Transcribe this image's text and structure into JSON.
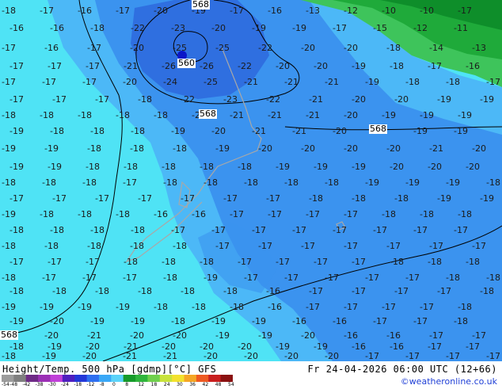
{
  "footer": {
    "title": "Height/Temp. 500 hPa [gdmp][°C] GFS",
    "datetime": "Fr 24-04-2026 06:00 UTC (12+66)",
    "credit": "©weatheronline.co.uk"
  },
  "colorbar": {
    "ticks": [
      "-54",
      "-48",
      "-42",
      "-38",
      "-30",
      "-24",
      "-18",
      "-12",
      "-8",
      "0",
      "8",
      "12",
      "18",
      "24",
      "30",
      "36",
      "42",
      "48",
      "54"
    ],
    "colors": [
      "#9c9c9c",
      "#7f7f7f",
      "#6e2a86",
      "#9b2fb5",
      "#c040d8",
      "#4f1fbf",
      "#2337d8",
      "#2e6ff0",
      "#3aa8f7",
      "#5bd3f9",
      "#169a2a",
      "#2fb53c",
      "#6fd04c",
      "#c8e23a",
      "#f3e12e",
      "#f5a626",
      "#ee5a22",
      "#c81e1e",
      "#8a1111"
    ]
  },
  "colors": {
    "band_cyan": "#4fe3f5",
    "band_light_blue": "#4cb8f7",
    "band_blue": "#3b93ef",
    "band_dark_blue": "#2f6fe0",
    "band_green_dark": "#0e8e2a",
    "band_green": "#1faa3a",
    "band_green_light": "#3ec45b",
    "land_outline": "#a8a8a8",
    "isoline": "#000000",
    "low_center": "#0a16c8"
  },
  "isoline_labels": [
    "568",
    "560",
    "568",
    "568",
    "568"
  ],
  "temperature_labels": [
    "-18",
    "-17",
    "-16",
    "-17",
    "-20",
    "-19",
    "-17",
    "-16",
    "-13",
    "-12",
    "-10",
    "-10",
    "-17",
    "-16",
    "-16",
    "-18",
    "-22",
    "-23",
    "-20",
    "-19",
    "-19",
    "-17",
    "-15",
    "-12",
    "-11",
    "-17",
    "-16",
    "-17",
    "-20",
    "-25",
    "-25",
    "-22",
    "-20",
    "-20",
    "-18",
    "-14",
    "-13",
    "-17",
    "-17",
    "-17",
    "-21",
    "-26",
    "-26",
    "-22",
    "-20",
    "-20",
    "-19",
    "-18",
    "-17",
    "-16",
    "-17",
    "-17",
    "-17",
    "-20",
    "-24",
    "-25",
    "-21",
    "-21",
    "-21",
    "-19",
    "-18",
    "-18",
    "-17",
    "-17",
    "-17",
    "-17",
    "-18",
    "-22",
    "-23",
    "-22",
    "-21",
    "-20",
    "-20",
    "-19",
    "-19",
    "-18",
    "-18",
    "-18",
    "-18",
    "-18",
    "-20",
    "-21",
    "-21",
    "-21",
    "-20",
    "-19",
    "-19",
    "-19",
    "-19",
    "-18",
    "-18",
    "-18",
    "-19",
    "-20",
    "-21",
    "-21",
    "-20",
    "-20",
    "-19",
    "-19",
    "-19",
    "-19",
    "-18",
    "-18",
    "-18",
    "-19",
    "-20",
    "-20",
    "-20",
    "-20",
    "-21",
    "-20",
    "-19",
    "-19",
    "-18",
    "-18",
    "-18",
    "-18",
    "-18",
    "-19",
    "-19",
    "-19",
    "-20",
    "-20",
    "-20",
    "-18",
    "-18",
    "-18",
    "-17",
    "-18",
    "-18",
    "-18",
    "-18",
    "-18",
    "-19",
    "-19",
    "-19",
    "-18",
    "-17",
    "-17",
    "-17",
    "-17",
    "-17",
    "-17",
    "-17",
    "-18",
    "-18",
    "-18",
    "-19",
    "-19",
    "-19",
    "-18",
    "-18",
    "-18",
    "-16",
    "-16",
    "-17",
    "-17",
    "-17",
    "-17",
    "-18",
    "-18",
    "-18",
    "-18",
    "-18",
    "-18",
    "-18",
    "-17",
    "-17",
    "-17",
    "-17",
    "-17",
    "-17",
    "-17",
    "-17",
    "-18",
    "-18",
    "-18",
    "-18",
    "-18",
    "-17",
    "-17",
    "-17",
    "-17",
    "-17",
    "-17",
    "-17",
    "-17",
    "-17",
    "-17",
    "-18",
    "-18",
    "-18",
    "-17",
    "-17",
    "-17",
    "-17",
    "-18",
    "-18",
    "-18",
    "-18",
    "-17",
    "-17",
    "-17",
    "-18",
    "-19",
    "-17",
    "-17",
    "-17",
    "-17",
    "-17",
    "-18",
    "-18",
    "-18",
    "-18",
    "-18",
    "-18",
    "-18",
    "-18",
    "-16",
    "-17",
    "-17",
    "-17",
    "-17",
    "-18",
    "-19",
    "-19",
    "-19",
    "-19",
    "-18",
    "-18",
    "-18",
    "-16",
    "-17",
    "-17",
    "-17",
    "-17",
    "-18",
    "-19",
    "-20",
    "-19",
    "-19",
    "-18",
    "-19",
    "-19",
    "-16",
    "-16",
    "-17",
    "-17",
    "-18",
    "-19",
    "-20",
    "-21",
    "-20",
    "-20",
    "-19",
    "-19",
    "-20",
    "-16",
    "-16",
    "-17",
    "-17",
    "-18",
    "-19",
    "-20",
    "-21",
    "-20",
    "-20",
    "-20",
    "-19",
    "-19",
    "-16",
    "-16",
    "-17",
    "-17",
    "-18",
    "-19",
    "-20",
    "-21",
    "-21",
    "-20",
    "-20",
    "-20",
    "-20",
    "-17",
    "-17",
    "-17",
    "-17",
    "-18",
    "-19",
    "-19",
    "-20",
    "-21",
    "-20",
    "-21",
    "-22",
    "-22"
  ]
}
